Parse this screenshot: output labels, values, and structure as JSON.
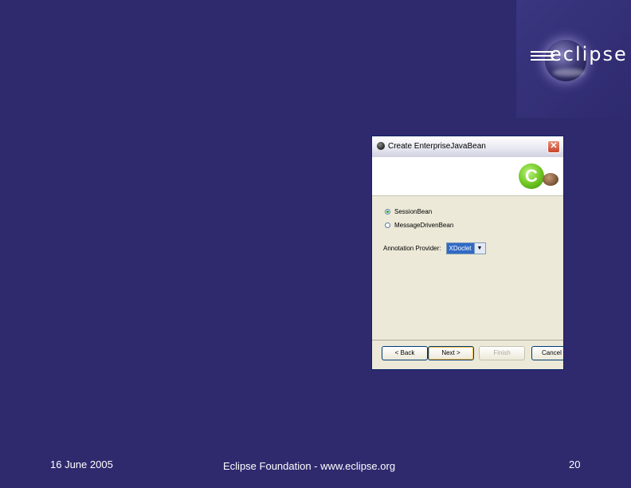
{
  "logo": {
    "text": "eclipse"
  },
  "dialog": {
    "title": "Create EnterpriseJavaBean",
    "close_glyph": "✕",
    "banner_glyph": "C",
    "options": [
      {
        "label": "SessionBean",
        "checked": true
      },
      {
        "label": "MessageDrivenBean",
        "checked": false
      }
    ],
    "provider_label": "Annotation Provider:",
    "provider_value": "XDoclet",
    "dropdown_glyph": "▼",
    "buttons": {
      "back": "< Back",
      "next": "Next >",
      "finish": "Finish",
      "cancel": "Cancel"
    }
  },
  "footer": {
    "date": "16 June 2005",
    "center": "Eclipse Foundation - www.eclipse.org",
    "page": "20"
  },
  "colors": {
    "background": "#2f2a6e",
    "dialog_bg": "#ece9d8",
    "selection": "#316ac5"
  }
}
